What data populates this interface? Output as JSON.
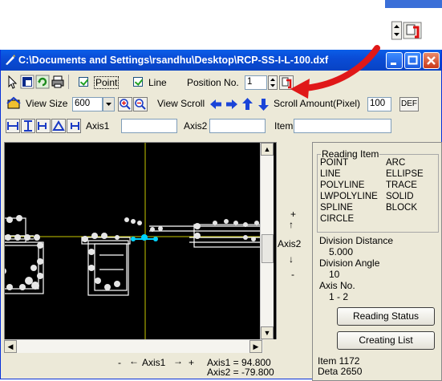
{
  "window": {
    "title": "C:\\Documents and Settings\\rsandhu\\Desktop\\RCP-SS-I-L-100.dxf"
  },
  "toolbar1": {
    "point_label": "Point",
    "point_checked": true,
    "line_label": "Line",
    "line_checked": true,
    "position_label": "Position No.",
    "position_value": "1"
  },
  "toolbar2": {
    "view_size_label": "View Size",
    "view_size_value": "600",
    "view_scroll_label": "View Scroll",
    "scroll_amount_label": "Scroll Amount(Pixel)",
    "scroll_amount_value": "100",
    "def_label": "DEF"
  },
  "toolbar3": {
    "axis1_label": "Axis1",
    "axis1_value": "",
    "axis2_label": "Axis2",
    "axis2_value": "",
    "item_label": "Item",
    "item_value": ""
  },
  "axis_nav": {
    "plus": "+",
    "up": "↑",
    "axis2": "Axis2",
    "down": "↓",
    "minus": "-",
    "h_minus": "-",
    "h_left": "←",
    "h_axis1": "Axis1",
    "h_right": "→",
    "h_plus": "+"
  },
  "coords": {
    "axis1": "Axis1 = 94.800",
    "axis2": "Axis2 = -79.800"
  },
  "reading_item": {
    "title": "Reading Item",
    "left": [
      "POINT",
      "LINE",
      "POLYLINE",
      "LWPOLYLINE",
      "SPLINE",
      "CIRCLE"
    ],
    "right": [
      "ARC",
      "ELLIPSE",
      "TRACE",
      "SOLID",
      "BLOCK"
    ]
  },
  "division": {
    "distance_label": "Division Distance",
    "distance_value": "5.000",
    "angle_label": "Division Angle",
    "angle_value": "10",
    "axis_label": "Axis No.",
    "axis_value": "1 - 2"
  },
  "buttons": {
    "reading_status": "Reading Status",
    "creating_list": "Creating List"
  },
  "stats": {
    "item": "Item 1172",
    "deta": "Deta 2650"
  },
  "colors": {
    "titlebar": "#0a4cd6",
    "canvas_bg": "#000000",
    "crosshair": "#c8c800",
    "highlight": "#00d4ff",
    "arrow": "#e01818"
  }
}
